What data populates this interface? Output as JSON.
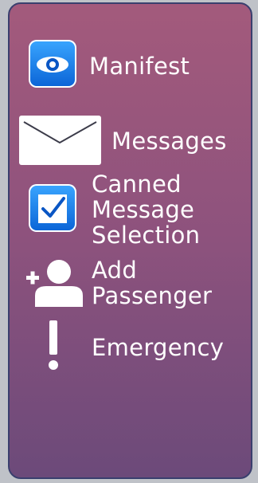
{
  "menu": {
    "items": [
      {
        "label": "Manifest",
        "icon": "eye-icon"
      },
      {
        "label": "Messages",
        "icon": "envelope-icon"
      },
      {
        "label": "Canned\nMessage\nSelection",
        "label_lines": [
          "Canned",
          "Message",
          "Selection"
        ],
        "icon": "checkbox-icon"
      },
      {
        "label": "Add Passenger",
        "label_lines": [
          "Add",
          "Passenger"
        ],
        "icon": "add-person-icon"
      },
      {
        "label": "Emergency",
        "icon": "exclamation-icon"
      }
    ]
  },
  "colors": {
    "panel_top": "#a35a7c",
    "panel_bottom": "#6c4a7a",
    "border": "#3a3f6e",
    "icon_blue": "#0a63d6"
  }
}
